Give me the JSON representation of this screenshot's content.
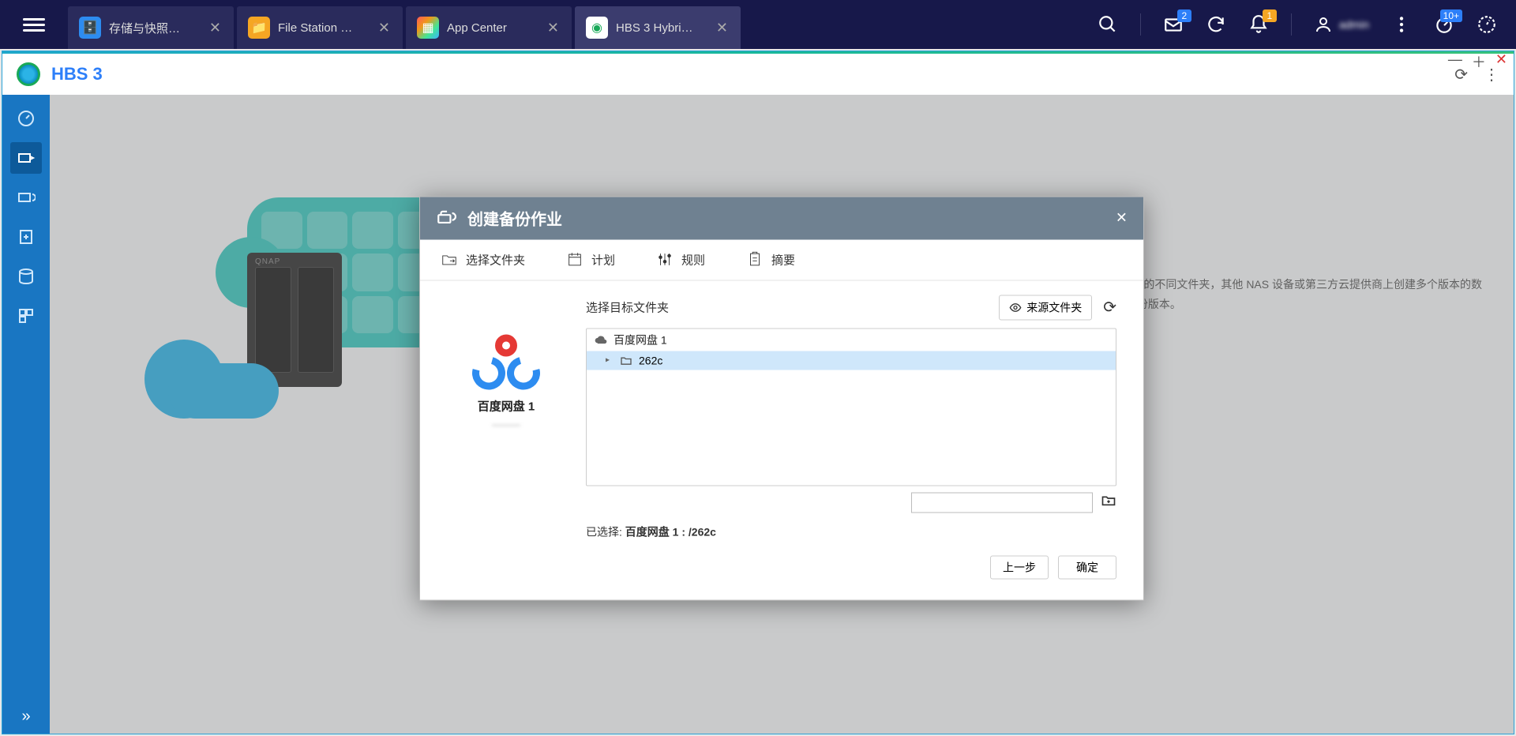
{
  "taskbar": {
    "tabs": [
      {
        "label": "存储与快照…",
        "icon_bg": "#2d8cf0"
      },
      {
        "label": "File Station …",
        "icon_bg": "#f5a623"
      },
      {
        "label": "App Center",
        "icon_bg": "#ffffff"
      },
      {
        "label": "HBS 3 Hybri…",
        "icon_bg": "#ffffff"
      }
    ],
    "badges": {
      "mail": "2",
      "bell": "1",
      "dash": "10+"
    },
    "user": "admin"
  },
  "app": {
    "title": "HBS 3"
  },
  "bg": {
    "line1": "AS 的不同文件夹，其他 NAS 设备或第三方云提供商上创建多个版本的数",
    "line2": "备份版本。"
  },
  "modal": {
    "title": "创建备份作业",
    "steps": [
      "选择文件夹",
      "计划",
      "规则",
      "摘要"
    ],
    "dest_heading": "选择目标文件夹",
    "source_btn": "来源文件夹",
    "account_name": "百度网盘 1",
    "account_sub": "———",
    "tree_root": "百度网盘 1",
    "tree_child": "262c",
    "path_value": "",
    "selected_prefix": "已选择:",
    "selected_value": "百度网盘 1 : /262c",
    "btn_prev": "上一步",
    "btn_ok": "确定"
  }
}
